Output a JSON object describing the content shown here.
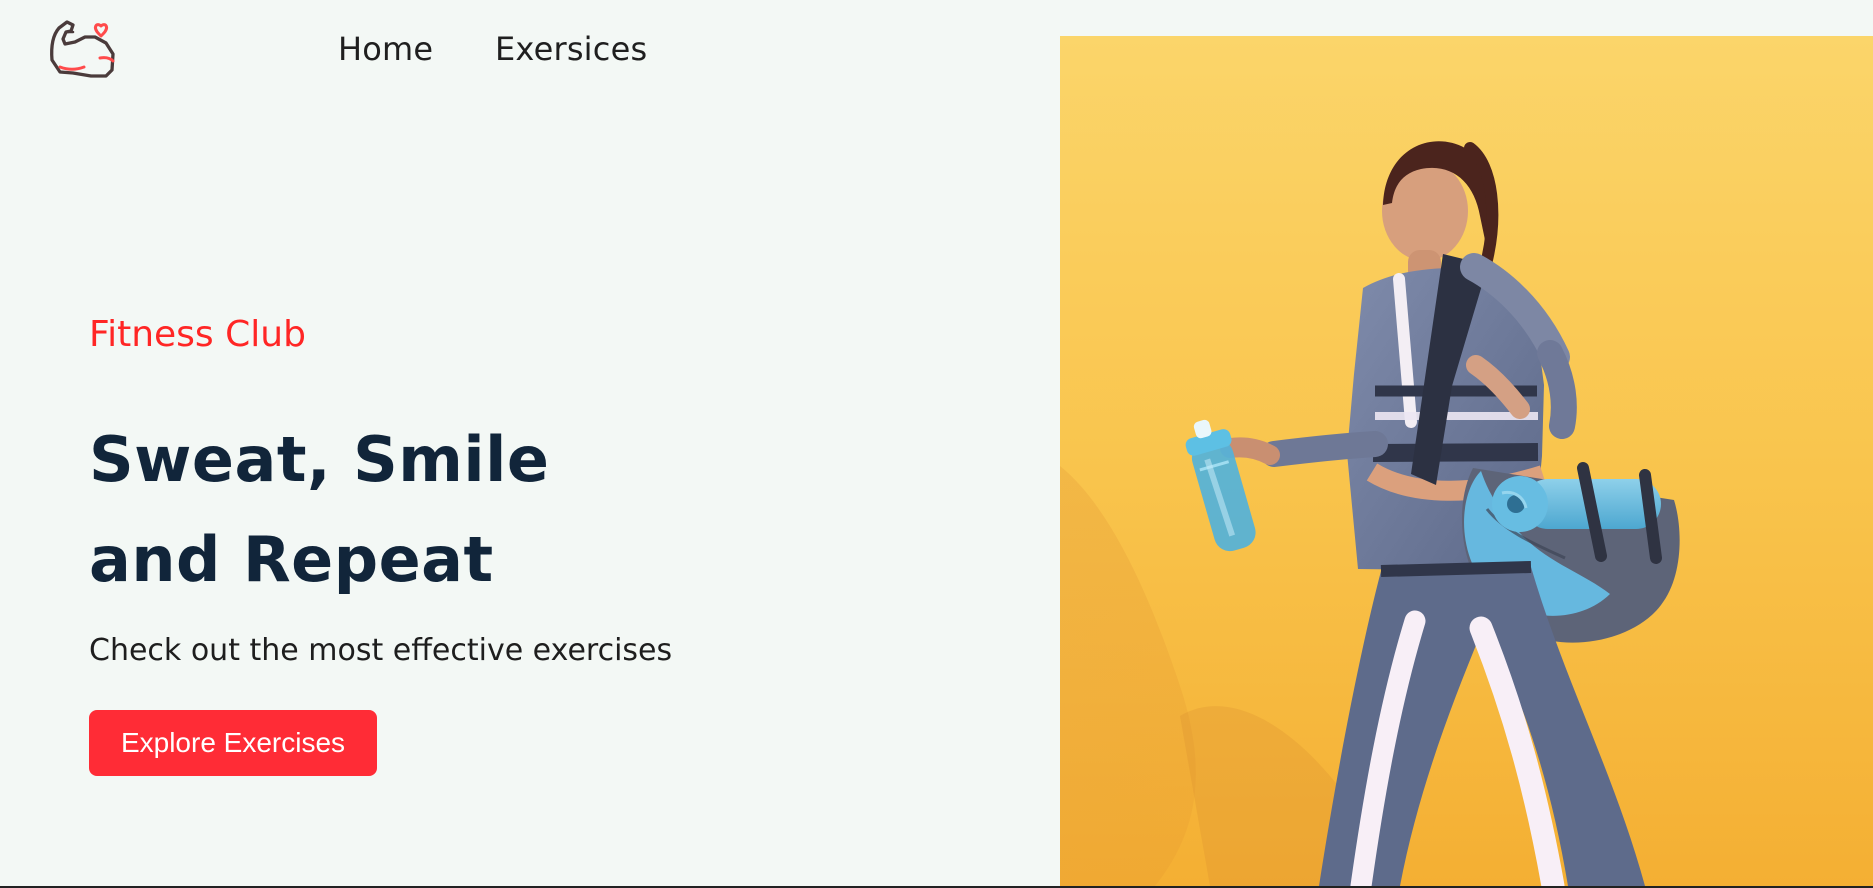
{
  "nav": {
    "logo_icon": "flexed-arm-heart-icon",
    "items": [
      {
        "label": "Home"
      },
      {
        "label": "Exersices"
      }
    ]
  },
  "hero": {
    "eyebrow": "Fitness Club",
    "headline": [
      "Sweat, Smile",
      "and Repeat"
    ],
    "subtitle": "Check out the most effective exercises",
    "cta_label": "Explore Exercises",
    "accent_color": "#ff2625",
    "button_color": "#ff2c36",
    "headline_color": "#11253a",
    "image_subject": "woman-walking-with-gym-bag-and-yoga-mat"
  }
}
